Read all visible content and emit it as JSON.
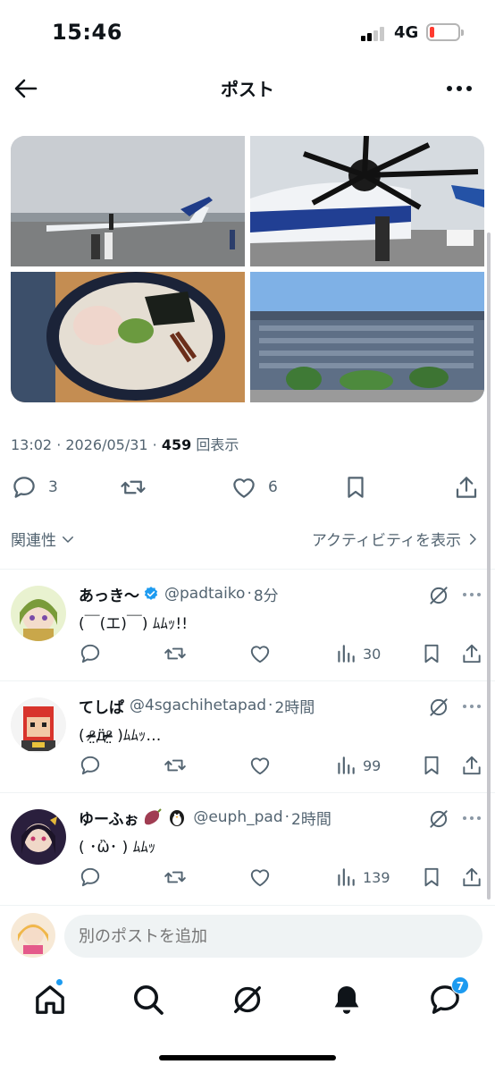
{
  "status_bar": {
    "time": "15:46",
    "network": "4G"
  },
  "nav": {
    "title": "ポスト"
  },
  "post": {
    "time": "13:02",
    "sep": " · ",
    "date": "2026/05/31",
    "views_count": "459",
    "views_label": "回表示",
    "reply_count": "3",
    "like_count": "6"
  },
  "sort": {
    "label": "関連性",
    "activity_label": "アクティビティを表示"
  },
  "replies": [
    {
      "name": "あっき～",
      "handle": "@padtaiko",
      "dot": "·",
      "time": "8分",
      "text": "(￣(エ)￣) ﾑﾑｯ!!",
      "views": "30",
      "verified": true
    },
    {
      "name": "てしぱ",
      "handle": "@4sgachihetapad",
      "dot": "·",
      "time": "2時間",
      "text": "( ᵒ̴̶̷̤д̈ᵒ̴̶̷̤ )ﾑﾑｯ…",
      "views": "99"
    },
    {
      "name": "ゆーふぉ",
      "handle": "@euph_pad",
      "dot": "·",
      "time": "2時間",
      "text": "( ･ὢ･ ) ﾑﾑｯ",
      "views": "139"
    }
  ],
  "compose": {
    "placeholder": "別のポストを追加"
  },
  "tabbar": {
    "notification_badge": "7"
  },
  "colors": {
    "accent": "#1d9bf0",
    "muted": "#536471",
    "text": "#0f1419"
  }
}
